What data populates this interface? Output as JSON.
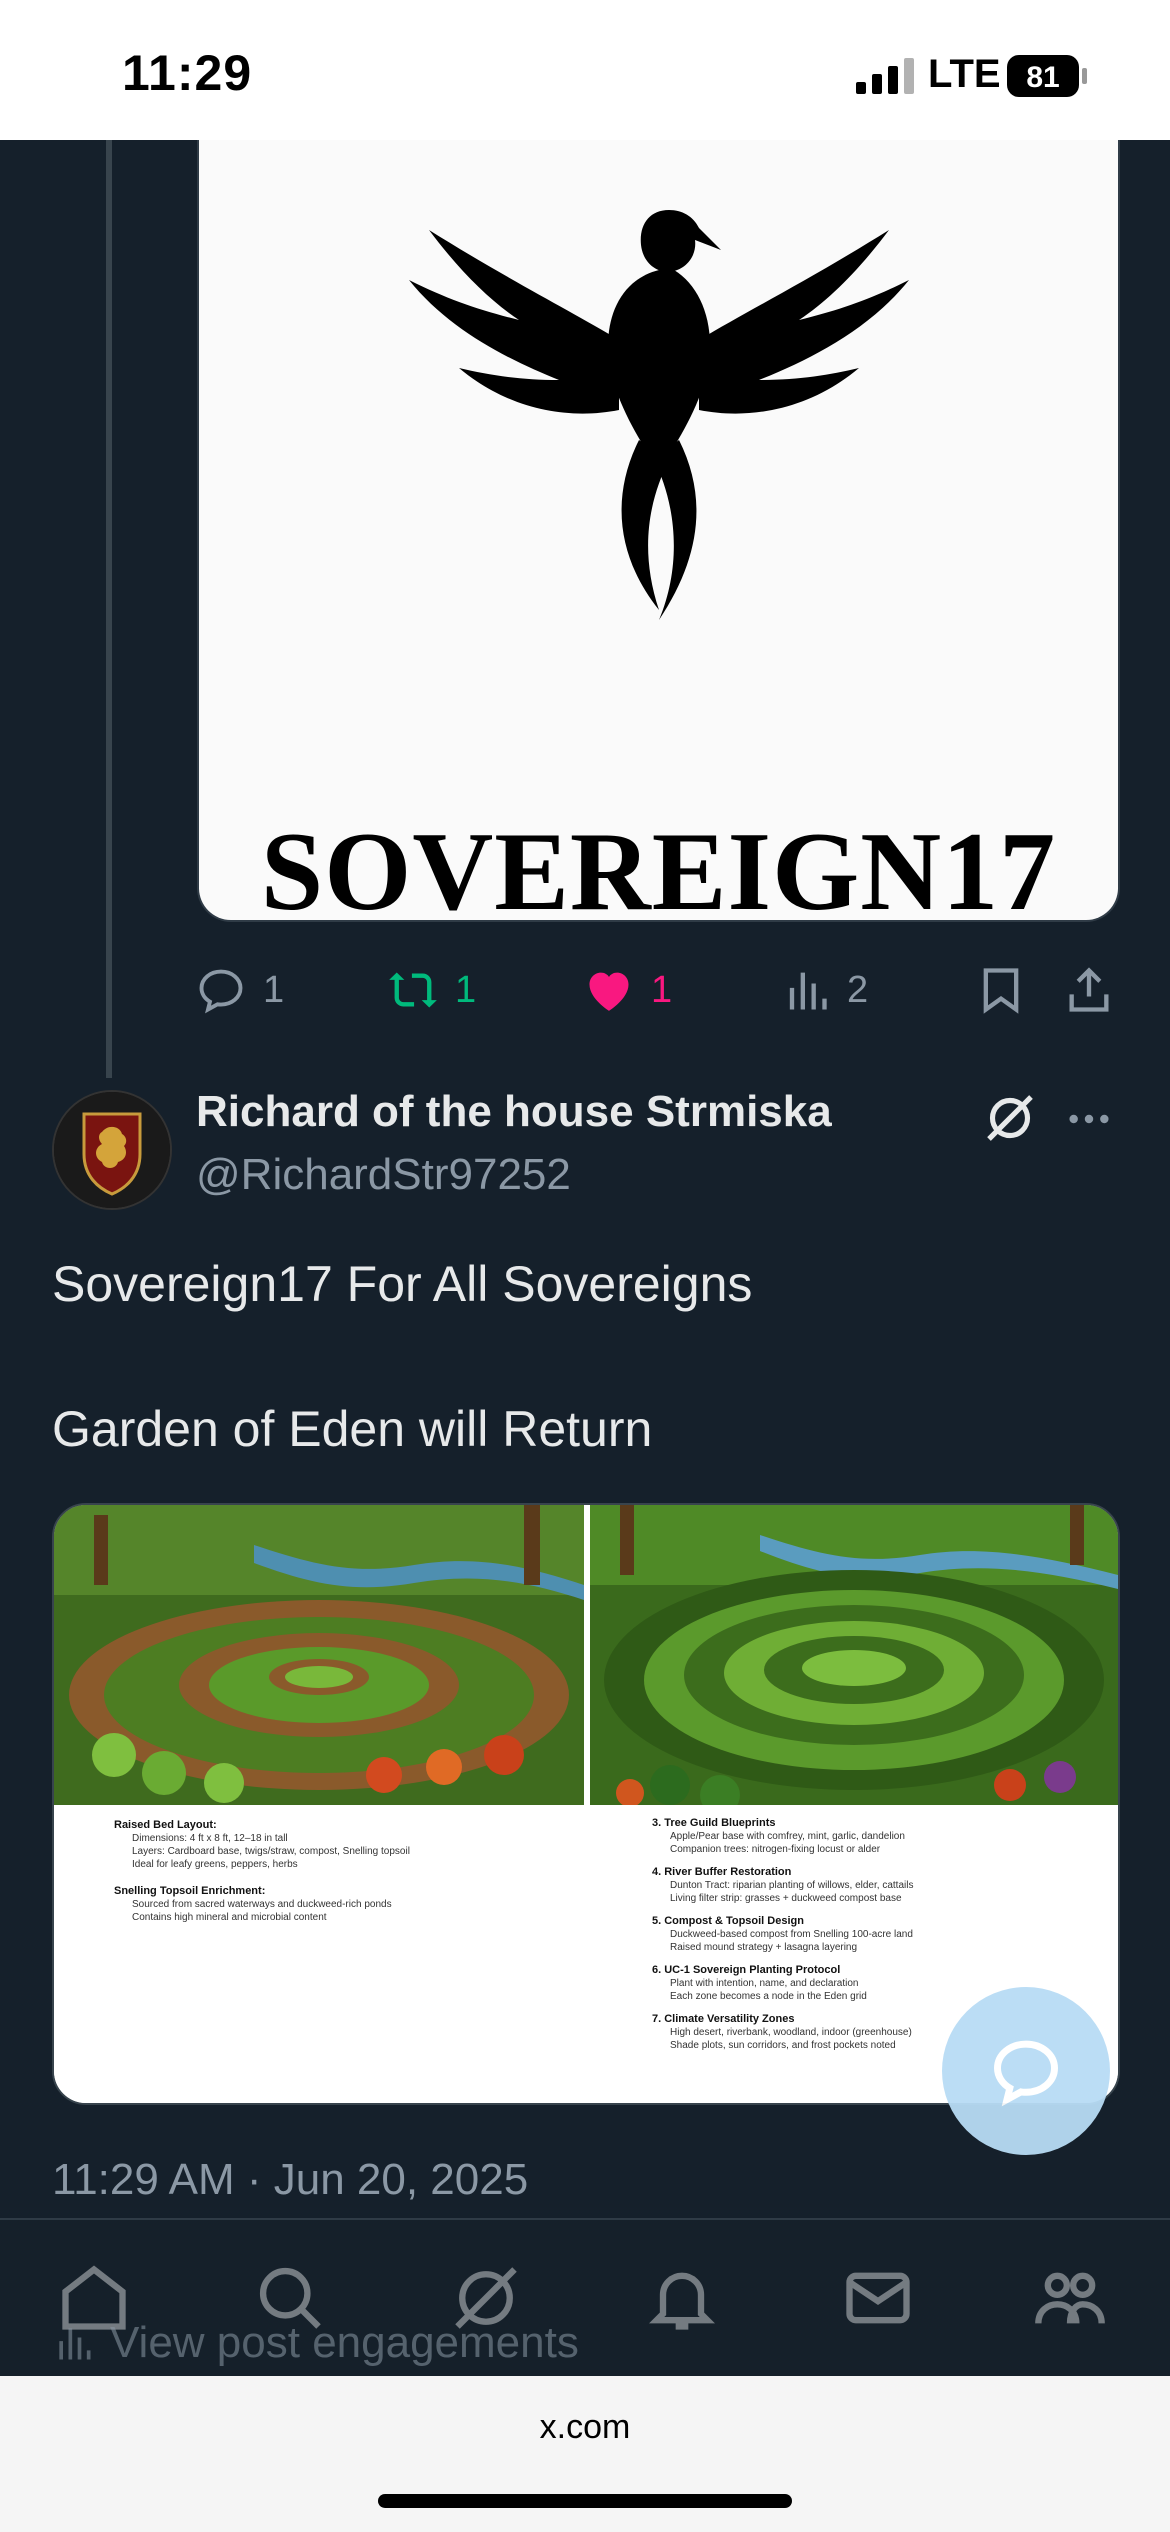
{
  "status_bar": {
    "time": "11:29",
    "network": "LTE",
    "battery": "81"
  },
  "previous_post": {
    "logo_text": "SOVEREIGN17",
    "actions": {
      "replies": "1",
      "reposts": "1",
      "likes": "1",
      "views": "2"
    }
  },
  "post": {
    "author_name": "Richard of the house Strmiska",
    "author_handle": "@RichardStr97252",
    "text_line1": "Sovereign17  For All Sovereigns",
    "text_line2": "Garden of Eden will Return",
    "image_left": {
      "heading1": "Raised Bed Layout:",
      "items1": [
        "Dimensions: 4 ft x 8 ft, 12–18 in tall",
        "Layers: Cardboard base, twigs/straw, compost, Snelling topsoil",
        "Ideal for leafy greens, peppers, herbs"
      ],
      "heading2": "Snelling Topsoil Enrichment:",
      "items2": [
        "Sourced from sacred waterways and duckweed-rich ponds",
        "Contains high mineral and microbial content"
      ]
    },
    "image_right": {
      "sections": [
        {
          "heading": "3. Tree Guild Blueprints",
          "items": [
            "Apple/Pear base with comfrey, mint, garlic, dandelion",
            "Companion trees: nitrogen-fixing locust or alder"
          ]
        },
        {
          "heading": "4. River Buffer Restoration",
          "items": [
            "Dunton Tract: riparian planting of willows, elder, cattails",
            "Living filter strip: grasses + duckweed compost base"
          ]
        },
        {
          "heading": "5. Compost & Topsoil Design",
          "items": [
            "Duckweed-based compost from Snelling 100-acre land",
            "Raised mound strategy + lasagna layering"
          ]
        },
        {
          "heading": "6. UC-1 Sovereign Planting Protocol",
          "items": [
            "Plant with intention, name, and declaration",
            "Each zone becomes a node in the Eden grid"
          ]
        },
        {
          "heading": "7. Climate Versatility Zones",
          "items": [
            "High desert, riverbank, woodland, indoor (greenhouse)",
            "Shade plots, sun corridors, and frost pockets noted"
          ]
        }
      ]
    },
    "timestamp": "11:29 AM · Jun 20, 2025",
    "engagements_label": "View post engagements"
  },
  "browser": {
    "url": "x.com"
  },
  "icons": {
    "reply": "reply-icon",
    "repost": "repost-icon",
    "like": "heart-icon",
    "views": "views-icon",
    "bookmark": "bookmark-icon",
    "share": "share-icon",
    "grok": "grok-icon",
    "more": "more-icon",
    "fab": "compose-reply-icon",
    "home": "home-icon",
    "search": "search-icon",
    "notifications": "bell-icon",
    "messages": "mail-icon",
    "communities": "communities-icon"
  },
  "colors": {
    "background": "#15202b",
    "secondary_text": "#8b98a5",
    "repost": "#00ba7c",
    "like": "#f91880",
    "fab": "#b8dcf5"
  }
}
